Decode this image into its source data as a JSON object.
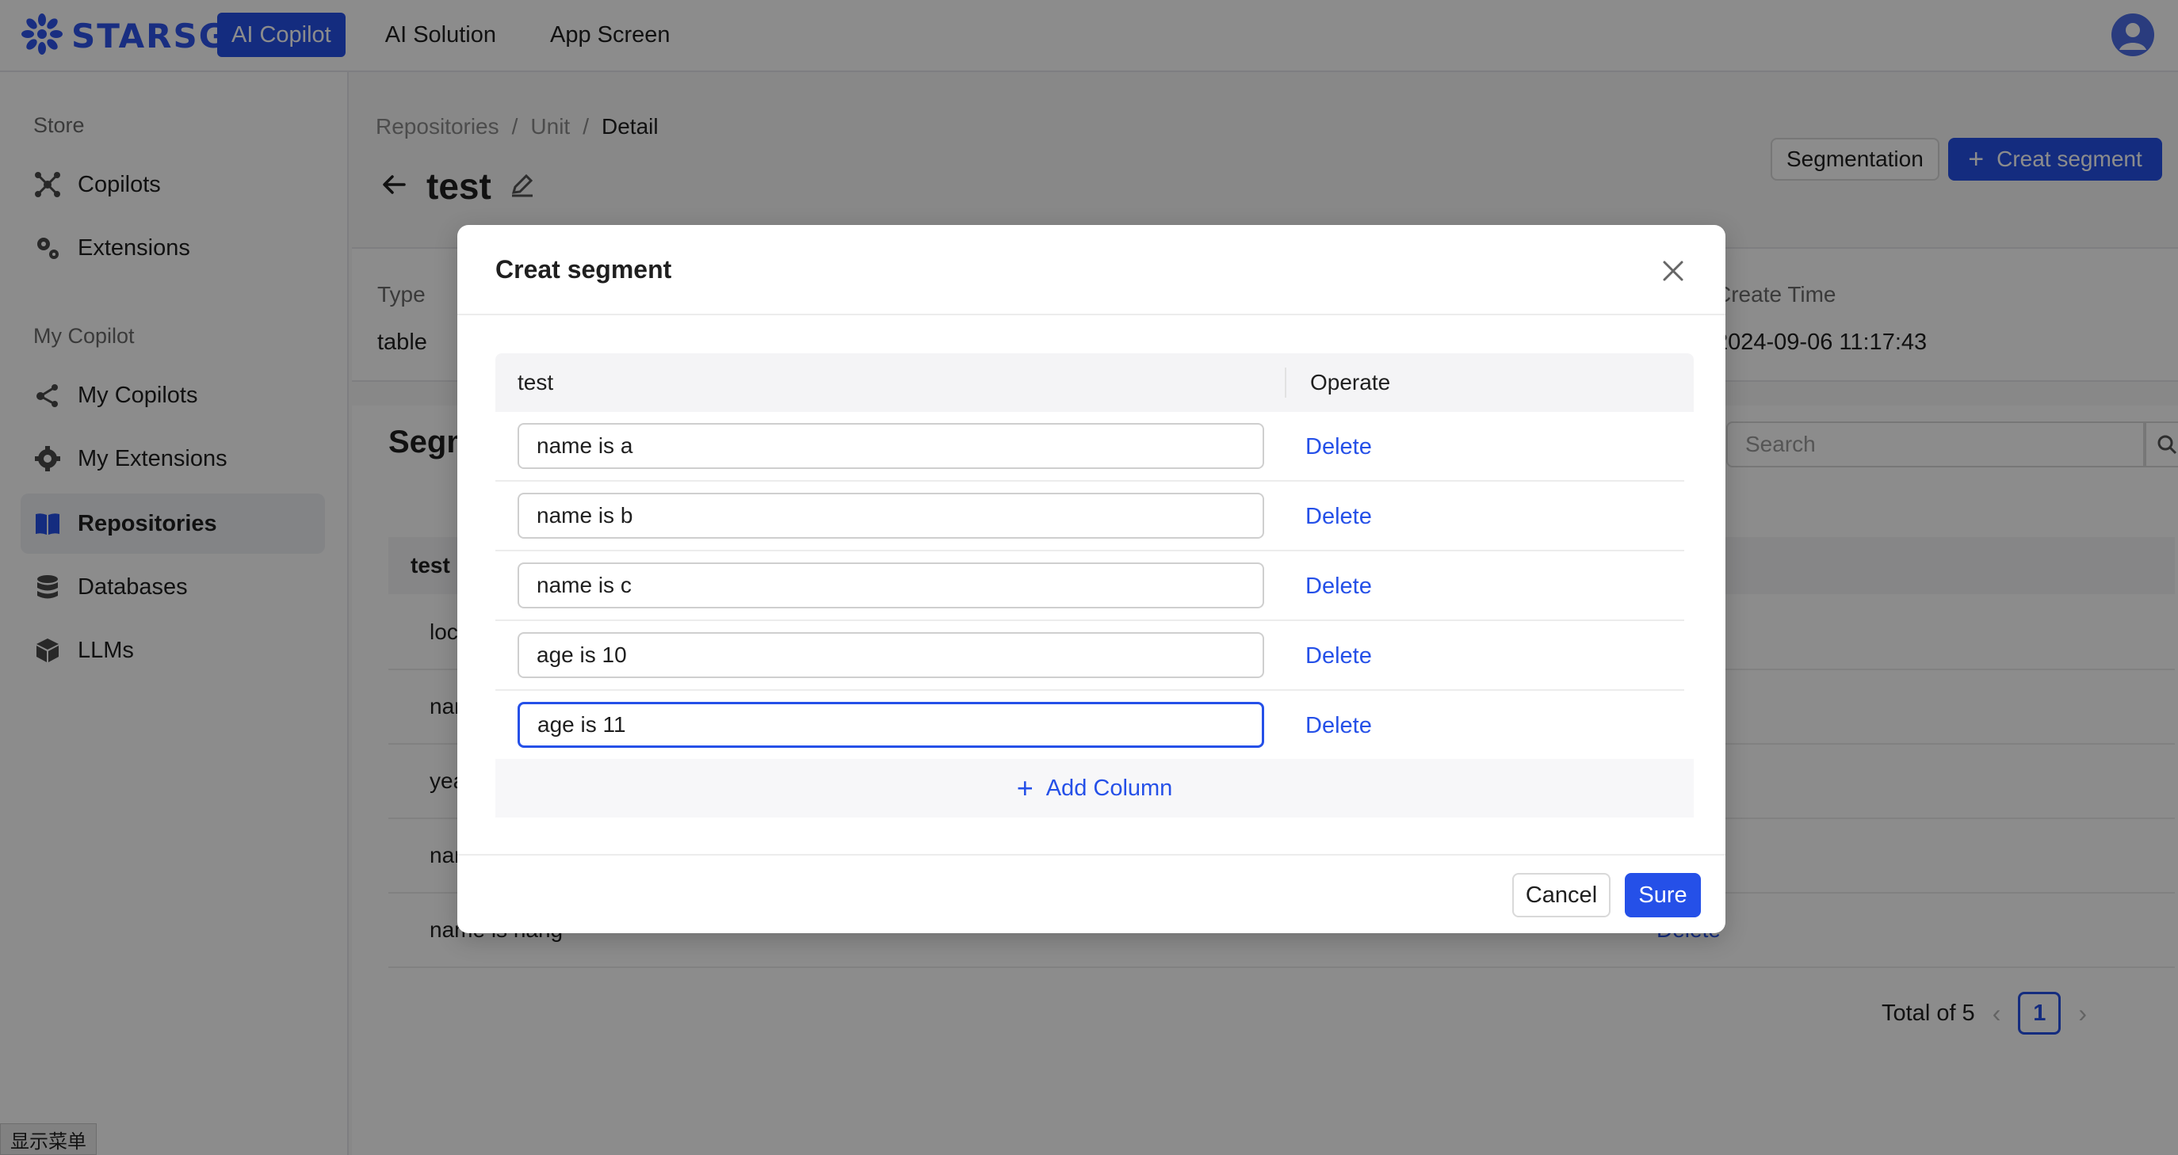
{
  "topbar": {
    "brand": "STARSG",
    "nav": [
      "AI Copilot",
      "AI Solution",
      "App Screen"
    ]
  },
  "sidebar": {
    "groups": [
      "Store",
      "My Copilot"
    ],
    "items": [
      {
        "label": "Copilots",
        "icon": "copilot-network-icon"
      },
      {
        "label": "Extensions",
        "icon": "gears-icon"
      },
      {
        "label": "My Copilots",
        "icon": "share-nodes-icon"
      },
      {
        "label": "My Extensions",
        "icon": "gear-icon"
      },
      {
        "label": "Repositories",
        "icon": "book-icon",
        "active": true
      },
      {
        "label": "Databases",
        "icon": "database-icon"
      },
      {
        "label": "LLMs",
        "icon": "cube-icon"
      }
    ]
  },
  "breadcrumb": [
    "Repositories",
    "Unit",
    "Detail"
  ],
  "page": {
    "title": "test",
    "segmentation_label": "Segmentation",
    "create_label": "Creat segment"
  },
  "info": {
    "type_label": "Type",
    "type_value": "table",
    "create_time_label": "Create Time",
    "create_time_value": "2024-09-06 11:17:43"
  },
  "segments": {
    "heading": "Segm",
    "search_placeholder": "Search",
    "column_header": "test",
    "rows": [
      "loc",
      "nar",
      "yea",
      "nar",
      "name is hang"
    ],
    "delete_label": "Delete",
    "total_label": "Total of 5",
    "current_page": "1"
  },
  "modal": {
    "title": "Creat segment",
    "col_header": "test",
    "operate_header": "Operate",
    "rows": [
      "name is a",
      "name is b",
      "name is c",
      "age is 10",
      "age is 11"
    ],
    "delete_label": "Delete",
    "add_column_label": "Add Column",
    "cancel_label": "Cancel",
    "sure_label": "Sure"
  },
  "tooltip": "显示菜单",
  "colors": {
    "accent": "#2550e8",
    "brand": "#2f54eb"
  }
}
